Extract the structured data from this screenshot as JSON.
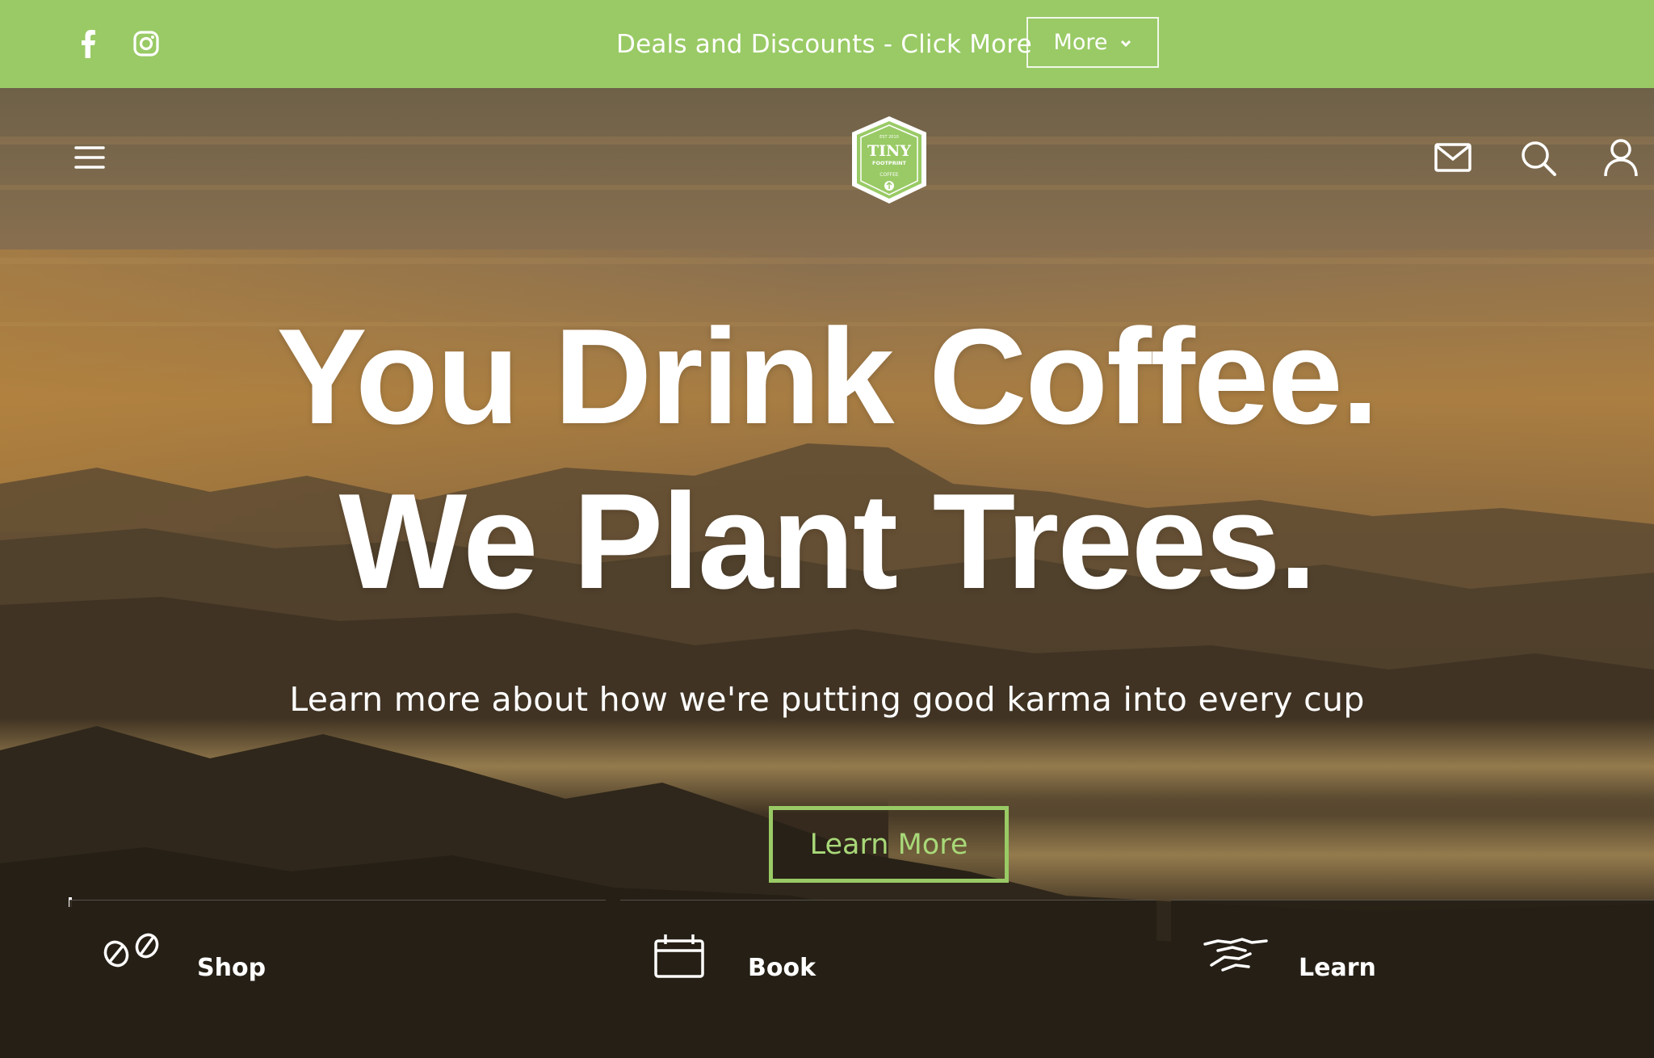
{
  "topbar": {
    "announcement": "Deals and Discounts - Click More",
    "more_label": "More",
    "social": [
      "facebook-icon",
      "instagram-icon"
    ],
    "background": "#99ca65"
  },
  "header": {
    "logo": {
      "line1": "TINY",
      "line2": "FOOTPRINT",
      "line3": "COFFEE",
      "est": "EST 2010",
      "color": "#99ca65"
    },
    "icons": [
      "menu-icon",
      "mail-icon",
      "search-icon",
      "account-icon"
    ]
  },
  "hero": {
    "headline_line1": "You Drink Coffee.",
    "headline_line2": "We Plant Trees.",
    "subheadline": "Learn more about how we're putting good karma into every cup",
    "cta_label": "Learn More",
    "accent": "#99ca65"
  },
  "tiles": [
    {
      "label": "Shop",
      "icon": "coffee-beans-icon"
    },
    {
      "label": "Book",
      "icon": "calendar-icon"
    },
    {
      "label": "Learn",
      "icon": "handshake-icon"
    }
  ]
}
